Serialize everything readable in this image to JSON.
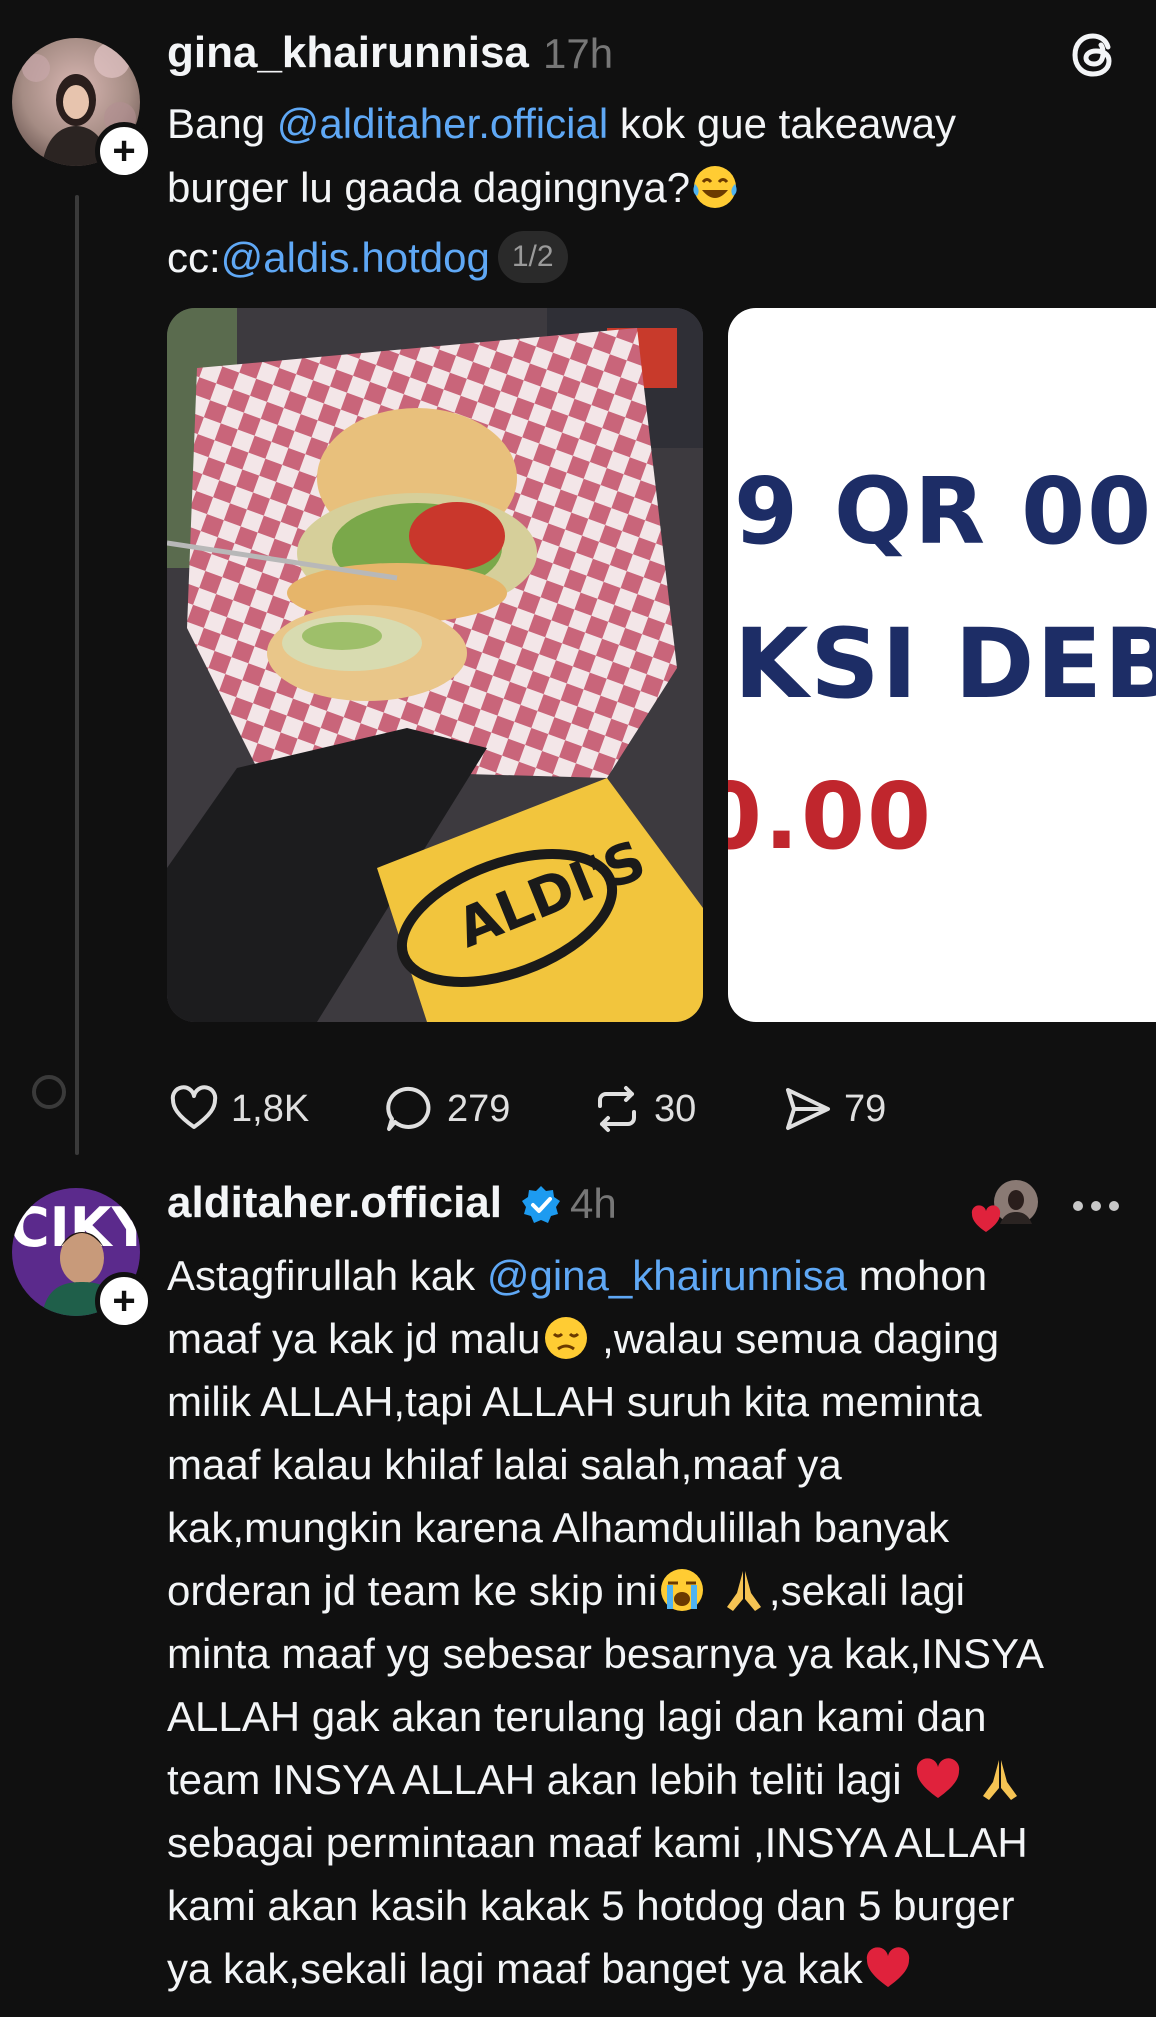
{
  "post": {
    "username": "gina_khairunnisa",
    "time": "17h",
    "text_line1_prefix": "Bang ",
    "text_line1_mention": "@alditaher.official",
    "text_line1_suffix": " kok gue takeaway",
    "text_line2": "burger lu gaada dagingnya?",
    "text_line3_prefix": "cc:",
    "text_line3_mention": "@aldis.hotdog",
    "page_indicator": "1/2",
    "media_2_lines": [
      "9 QR  00",
      "KSI DEB",
      "0.00"
    ],
    "actions": {
      "likes": "1,8K",
      "replies": "279",
      "reposts": "30",
      "shares": "79"
    }
  },
  "reply": {
    "username": "alditaher.official",
    "time": "4h",
    "line1_prefix": "Astagfirullah kak ",
    "line1_mention": "@gina_khairunnisa",
    "line1_suffix": " mohon",
    "line2_a": "maaf ya kak jd malu",
    "line2_b": " ,walau semua daging",
    "line3": "milik ALLAH,tapi ALLAH suruh kita meminta",
    "line4": "maaf kalau khilaf lalai salah,maaf ya",
    "line5": "kak,mungkin karena Alhamdulillah banyak",
    "line6_a": "orderan jd team ke skip ini",
    "line6_b": ",sekali lagi",
    "line7": "minta maaf yg sebesar besarnya ya kak,INSYA",
    "line8": "ALLAH gak akan terulang lagi dan kami dan",
    "line9": "team INSYA ALLAH akan lebih teliti lagi ",
    "line10": "sebagai permintaan maaf kami ,INSYA ALLAH",
    "line11": "kami akan kasih kakak 5 hotdog dan 5 burger",
    "line12": "ya kak,sekali lagi maaf banget ya kak"
  },
  "colors": {
    "background": "#101010",
    "text": "#f3f5f7",
    "mention": "#5fa8f5",
    "muted": "#777777",
    "verified": "#1d9bf0",
    "heart_red": "#e0223c"
  },
  "icons": [
    "threads-logo-icon",
    "heart-icon",
    "comment-icon",
    "repost-icon",
    "share-icon",
    "verified-icon",
    "more-icon",
    "plus-icon"
  ]
}
